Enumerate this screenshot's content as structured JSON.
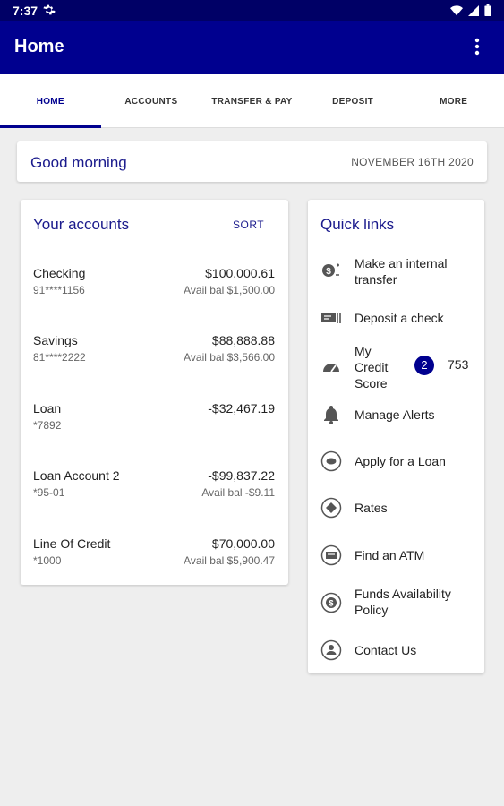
{
  "status_bar": {
    "time": "7:37"
  },
  "app_bar": {
    "title": "Home"
  },
  "tabs": [
    {
      "label": "HOME",
      "active": true
    },
    {
      "label": "ACCOUNTS"
    },
    {
      "label": "TRANSFER & PAY"
    },
    {
      "label": "DEPOSIT"
    },
    {
      "label": "MORE"
    }
  ],
  "greeting": {
    "text": "Good morning",
    "date": "NOVEMBER 16TH 2020"
  },
  "accounts": {
    "title": "Your accounts",
    "sort_label": "SORT",
    "items": [
      {
        "name": "Checking",
        "number": "91****1156",
        "balance": "$100,000.61",
        "available": "Avail bal $1,500.00"
      },
      {
        "name": "Savings",
        "number": "81****2222",
        "balance": "$88,888.88",
        "available": "Avail bal $3,566.00"
      },
      {
        "name": "Loan",
        "number": "*7892",
        "balance": "-$32,467.19",
        "available": ""
      },
      {
        "name": "Loan Account 2",
        "number": "*95-01",
        "balance": "-$99,837.22",
        "available": "Avail bal -$9.11"
      },
      {
        "name": "Line Of Credit",
        "number": "*1000",
        "balance": "$70,000.00",
        "available": "Avail bal $5,900.47"
      }
    ]
  },
  "quick_links": {
    "title": "Quick links",
    "items": [
      {
        "label": "Make an internal transfer",
        "icon": "transfer-icon"
      },
      {
        "label": "Deposit a check",
        "icon": "check-deposit-icon"
      },
      {
        "label": "My Credit Score",
        "icon": "gauge-icon",
        "badge": "2",
        "score": "753"
      },
      {
        "label": "Manage Alerts",
        "icon": "bell-icon"
      },
      {
        "label": "Apply for a Loan",
        "icon": "loan-icon"
      },
      {
        "label": "Rates",
        "icon": "rates-icon"
      },
      {
        "label": "Find an ATM",
        "icon": "atm-icon"
      },
      {
        "label": "Funds Availability Policy",
        "icon": "dollar-circle-icon"
      },
      {
        "label": "Contact Us",
        "icon": "person-icon"
      }
    ]
  },
  "colors": {
    "primary": "#00008f",
    "status_bar": "#000066",
    "accent_text": "#1a1a8c",
    "background": "#eeeeee"
  }
}
